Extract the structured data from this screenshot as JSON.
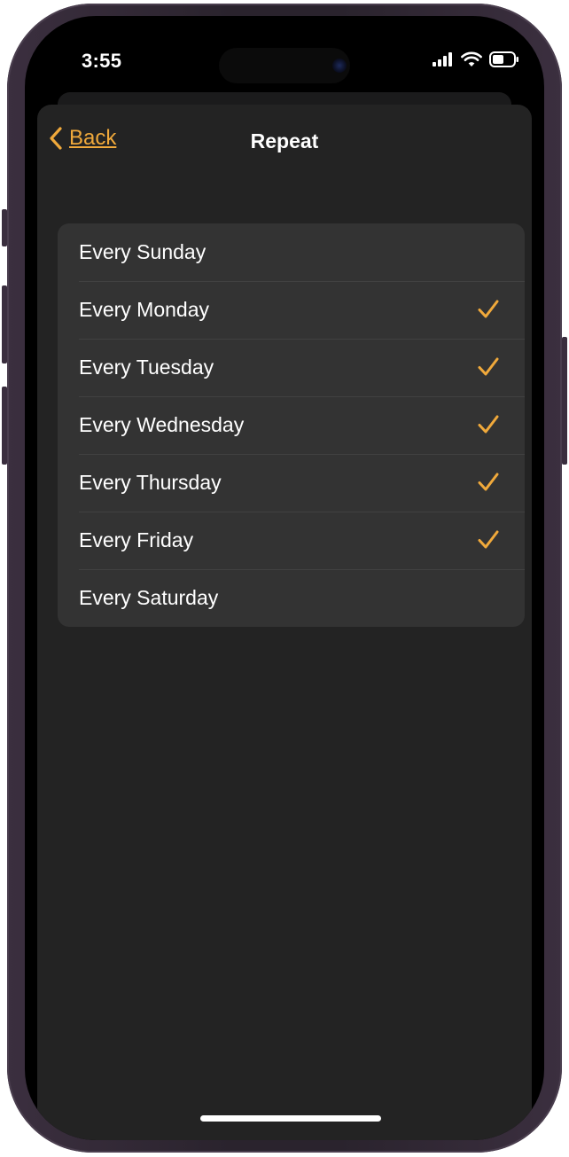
{
  "status_bar": {
    "time": "3:55"
  },
  "navigation": {
    "back_label": "Back",
    "title": "Repeat"
  },
  "repeat_options": [
    {
      "label": "Every Sunday",
      "checked": false
    },
    {
      "label": "Every Monday",
      "checked": true
    },
    {
      "label": "Every Tuesday",
      "checked": true
    },
    {
      "label": "Every Wednesday",
      "checked": true
    },
    {
      "label": "Every Thursday",
      "checked": true
    },
    {
      "label": "Every Friday",
      "checked": true
    },
    {
      "label": "Every Saturday",
      "checked": false
    }
  ],
  "colors": {
    "accent": "#f0a93b",
    "sheet_background": "#232323",
    "list_background": "#333333",
    "text": "#ffffff"
  },
  "icons": {
    "back": "chevron-left-icon",
    "check": "checkmark-icon",
    "signal": "cellular-signal-icon",
    "wifi": "wifi-icon",
    "battery": "battery-icon"
  }
}
